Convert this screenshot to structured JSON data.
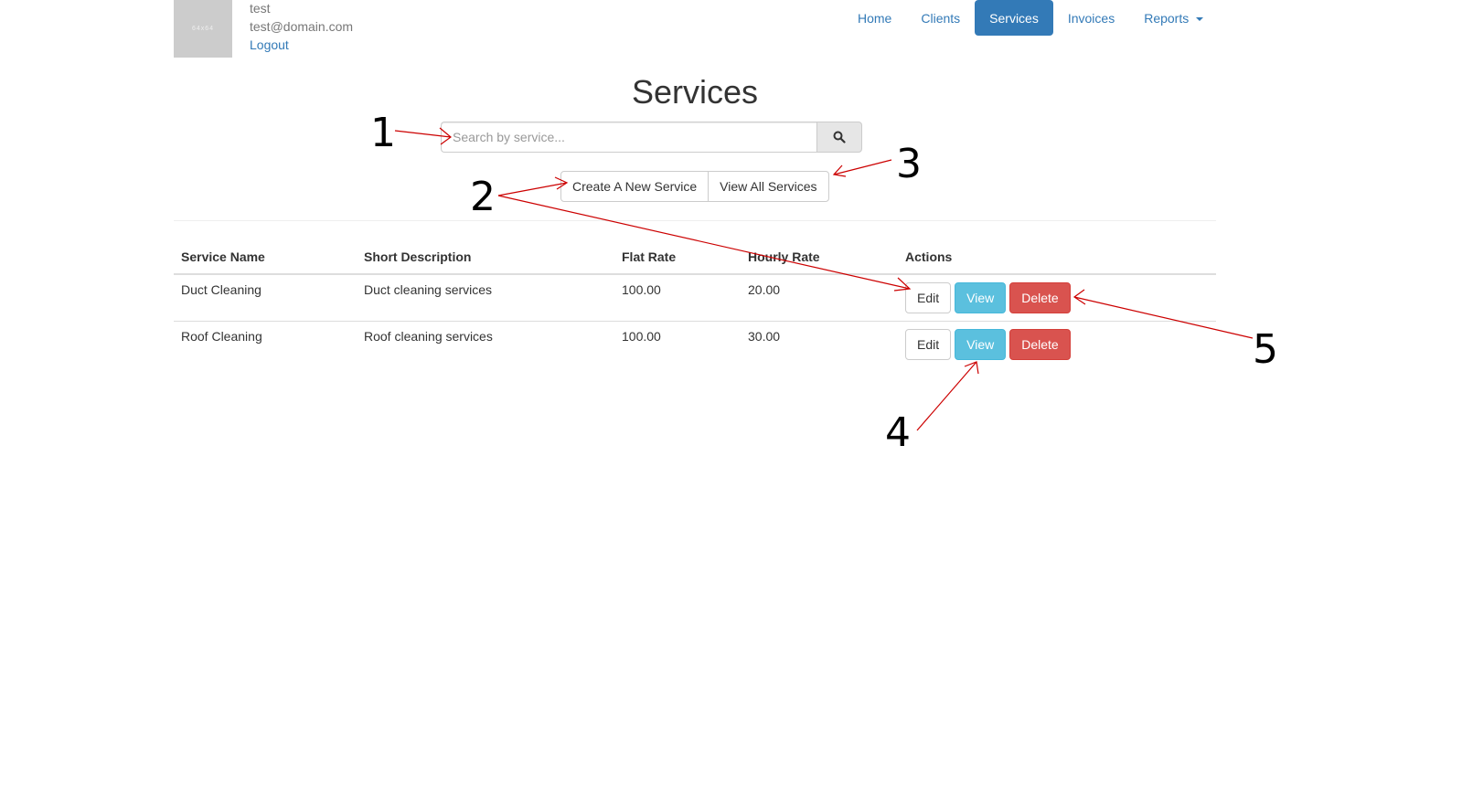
{
  "user": {
    "avatar_text": "64x64",
    "name": "test",
    "email": "test@domain.com",
    "logout_label": "Logout"
  },
  "nav": {
    "items": [
      {
        "label": "Home"
      },
      {
        "label": "Clients"
      },
      {
        "label": "Services",
        "active": true
      },
      {
        "label": "Invoices"
      },
      {
        "label": "Reports",
        "dropdown": true
      }
    ]
  },
  "page": {
    "title": "Services"
  },
  "search": {
    "placeholder": "Search by service...",
    "value": "",
    "button_icon": "search-icon"
  },
  "actions": {
    "create_label": "Create A New Service",
    "view_all_label": "View All Services"
  },
  "table": {
    "headers": [
      "Service Name",
      "Short Description",
      "Flat Rate",
      "Hourly Rate",
      "Actions"
    ],
    "rows": [
      {
        "name": "Duct Cleaning",
        "description": "Duct cleaning services",
        "flat_rate": "100.00",
        "hourly_rate": "20.00"
      },
      {
        "name": "Roof Cleaning",
        "description": "Roof cleaning services",
        "flat_rate": "100.00",
        "hourly_rate": "30.00"
      }
    ],
    "row_actions": {
      "edit": "Edit",
      "view": "View",
      "delete": "Delete"
    }
  },
  "annotations": {
    "labels": [
      "1",
      "2",
      "3",
      "4",
      "5"
    ],
    "color": "#cc0000"
  },
  "colors": {
    "primary": "#337ab7",
    "info": "#5bc0de",
    "danger": "#d9534f"
  }
}
